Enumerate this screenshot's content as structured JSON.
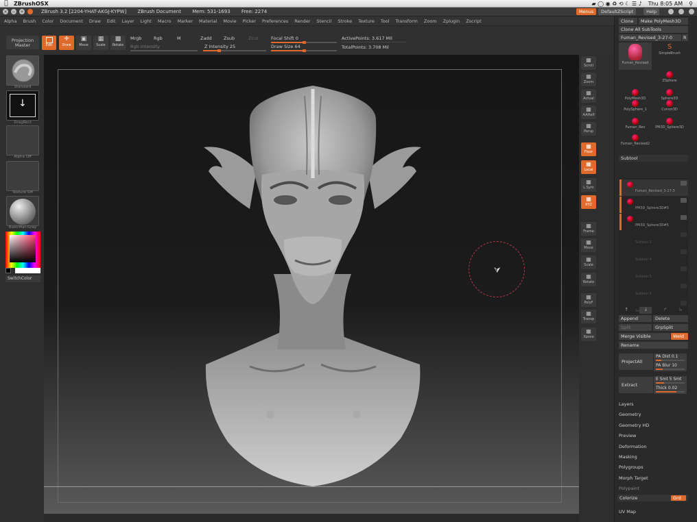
{
  "macbar": {
    "app_name": "ZBrushOSX",
    "clock": "Thu 8:05 AM"
  },
  "titlebar": {
    "version": "ZBrush 3.2 [2204-YHAT-AKGJ-KYPW]",
    "document": "ZBrush Document",
    "mem": "Mem: 531-1693",
    "free": "Free: 2274",
    "menus_btn": "Menus",
    "script_btn": "DefaultZScript",
    "help_btn": "Help"
  },
  "mainmenu": [
    "Alpha",
    "Brush",
    "Color",
    "Document",
    "Draw",
    "Edit",
    "Layer",
    "Light",
    "Macro",
    "Marker",
    "Material",
    "Movie",
    "Picker",
    "Preferences",
    "Render",
    "Stencil",
    "Stroke",
    "Texture",
    "Tool",
    "Transform",
    "Zoom",
    "Zplugin",
    "Zscript"
  ],
  "toolbar": {
    "projection_master": "Projection Master",
    "edit": "Edit",
    "draw": "Draw",
    "move": "Move",
    "scale": "Scale",
    "rotate": "Rotate",
    "mrgb": "Mrgb",
    "rgb": "Rgb",
    "m": "M",
    "rgb_intensity": "Rgb Intensity",
    "zadd": "Zadd",
    "zsub": "Zsub",
    "zcut": "Zcut",
    "z_intensity_label": "Z Intensity",
    "z_intensity_value": "25",
    "z_intensity_fraction": 0.25,
    "focal_shift_label": "Focal Shift",
    "focal_shift_value": "0",
    "focal_shift_fraction": 0.5,
    "draw_size_label": "Draw Size",
    "draw_size_value": "64",
    "draw_size_fraction": 0.5,
    "active_points": "ActivePoints: 3.617 Mil",
    "total_points": "TotalPoints: 3.708 Mil"
  },
  "leftpanel": {
    "brush_label": "Standard",
    "stroke_label": "DragRect",
    "alpha_label": "Alpha Off",
    "texture_label": "Texture Off",
    "material_label": "BasicMat-Gray",
    "switch_color": "SwitchColor"
  },
  "rightstrip": [
    {
      "label": "Scroll",
      "on": false
    },
    {
      "label": "Zoom",
      "on": false
    },
    {
      "label": "Actual",
      "on": false
    },
    {
      "label": "AAHalf",
      "on": false
    },
    {
      "label": "Persp",
      "on": false
    },
    {
      "label": "Floor",
      "on": true
    },
    {
      "label": "Local",
      "on": true
    },
    {
      "label": "L.Sym",
      "on": false
    },
    {
      "label": "XYZ",
      "on": true
    },
    {
      "label": "Frame",
      "on": false
    },
    {
      "label": "Move",
      "on": false
    },
    {
      "label": "Scale",
      "on": false
    },
    {
      "label": "Rotate",
      "on": false
    },
    {
      "label": "PolyF",
      "on": false
    },
    {
      "label": "Transp",
      "on": false
    },
    {
      "label": "Xpose",
      "on": false
    }
  ],
  "palette": {
    "clone": "Clone",
    "make_polymesh": "Make PolyMesh3D",
    "clone_all": "Clone All SubTools",
    "current_tool": "Fuman_Revised_3-27-0",
    "current_tool_short": "R",
    "tools": [
      {
        "name": "Fuman_Revised",
        "num": "7"
      },
      {
        "name": "SimpleBrush",
        "num": ""
      },
      {
        "name": "ZSphere",
        "num": ""
      },
      {
        "name": "PolyMesh3D",
        "num": ""
      },
      {
        "name": "Sphere3D",
        "num": ""
      },
      {
        "name": "PolySphere_1",
        "num": "2"
      },
      {
        "name": "Cursor3D",
        "num": ""
      },
      {
        "name": "Fuman_Rev",
        "num": "4"
      },
      {
        "name": "PM3D_Sphere3D",
        "num": "3"
      },
      {
        "name": "Fuman_Revised2",
        "num": "5"
      }
    ],
    "subtool_header": "Subtool",
    "subtools": [
      {
        "name": "Fuman_Revised_3-27-3",
        "empty": false
      },
      {
        "name": "PM3D_Sphere3D#5",
        "empty": false
      },
      {
        "name": "PM3D_Sphere3D#5",
        "empty": false
      },
      {
        "name": "Subtool 3",
        "empty": true
      },
      {
        "name": "Subtool 4",
        "empty": true
      },
      {
        "name": "Subtool 5",
        "empty": true
      },
      {
        "name": "Subtool 6",
        "empty": true
      },
      {
        "name": "Subtool 7",
        "empty": true
      }
    ],
    "append": "Append",
    "delete": "Delete",
    "split": "Split",
    "grp_split": "GrpSplit",
    "merge_visible": "Merge Visible",
    "weld": "Weld",
    "rename": "Rename",
    "project_all": "ProjectAll",
    "pa_dist": "PA Dist 0.1",
    "pa_blur": "PA Blur 10",
    "extract": "Extract",
    "e_smt": "E Smt 5 Smt",
    "thick": "Thick 0.02",
    "sections": [
      "Layers",
      "Geometry",
      "Geometry HD",
      "Preview",
      "Deformation",
      "Masking",
      "Polygroups",
      "Morph Target",
      "Polypaint"
    ],
    "colorize": "Colorize",
    "grd": "Grd",
    "uv_map": "UV Map"
  },
  "colors": {
    "accent": "#e06a2c",
    "panel": "#2e2e2e",
    "canvas_top": "#161616"
  }
}
